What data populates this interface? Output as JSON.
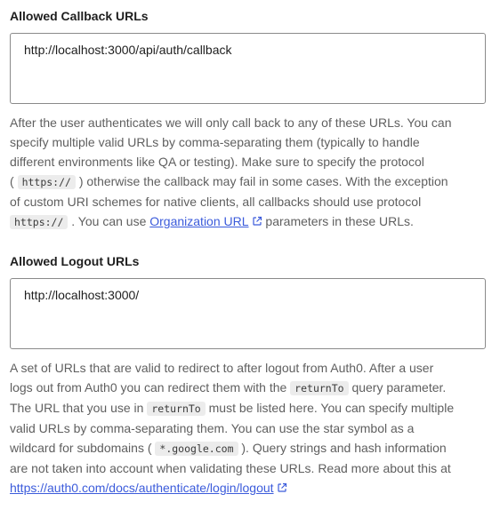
{
  "callback": {
    "label": "Allowed Callback URLs",
    "value": "http://localhost:3000/api/auth/callback",
    "help": {
      "l1": "After the user authenticates we will only call back to any of these URLs. You can",
      "l2": "specify multiple valid URLs by comma-separating them (typically to handle",
      "l3": "different environments like QA or testing). Make sure to specify the protocol",
      "l4a": "(",
      "l4code": "https://",
      "l4b": ") otherwise the callback may fail in some cases. With the exception",
      "l5": "of custom URI schemes for native clients, all callbacks should use protocol",
      "l6code": "https://",
      "l6a": ". You can use",
      "l6link": "Organization URL",
      "l6b": "parameters in these URLs."
    }
  },
  "logout": {
    "label": "Allowed Logout URLs",
    "value": "http://localhost:3000/",
    "help": {
      "l1": "A set of URLs that are valid to redirect to after logout from Auth0. After a user",
      "l2a": "logs out from Auth0 you can redirect them with the",
      "l2code": "returnTo",
      "l2b": "query parameter.",
      "l3a": "The URL that you use in",
      "l3code": "returnTo",
      "l3b": "must be listed here. You can specify multiple",
      "l4": "valid URLs by comma-separating them. You can use the star symbol as a",
      "l5a": "wildcard for subdomains (",
      "l5code": "*.google.com",
      "l5b": "). Query strings and hash information",
      "l6": "are not taken into account when validating these URLs. Read more about this at",
      "l7link": "https://auth0.com/docs/authenticate/login/logout"
    }
  },
  "colors": {
    "link": "#3b5bdb",
    "help_text": "#5f5f5f",
    "border": "#8a8a8a"
  },
  "icons": {
    "external_link": "external-link-icon"
  }
}
